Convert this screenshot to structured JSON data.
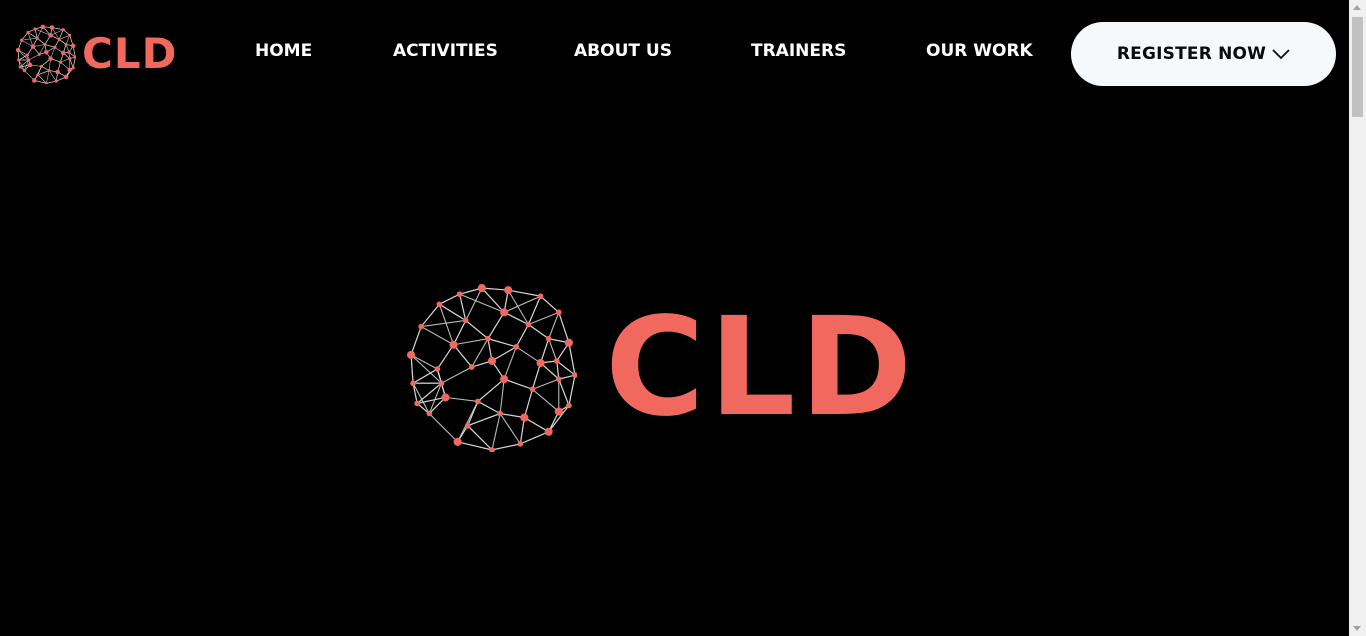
{
  "brand": {
    "name": "CLD",
    "color": "#f1695e"
  },
  "nav": {
    "items": [
      {
        "id": "home",
        "label": "HOME"
      },
      {
        "id": "activities",
        "label": "ACTIVITIES"
      },
      {
        "id": "about",
        "label": "ABOUT US"
      },
      {
        "id": "trainers",
        "label": "TRAINERS"
      },
      {
        "id": "work",
        "label": "OUR WORK"
      }
    ],
    "register_label": "REGISTER NOW",
    "register_icon": "chevron-down-icon"
  },
  "hero": {
    "logo_text": "CLD",
    "logo_icon": "network-globe-icon"
  },
  "colors": {
    "background": "#000000",
    "accent": "#f1695e",
    "nav_text": "#ffffff",
    "button_bg": "#f6f9fc"
  }
}
